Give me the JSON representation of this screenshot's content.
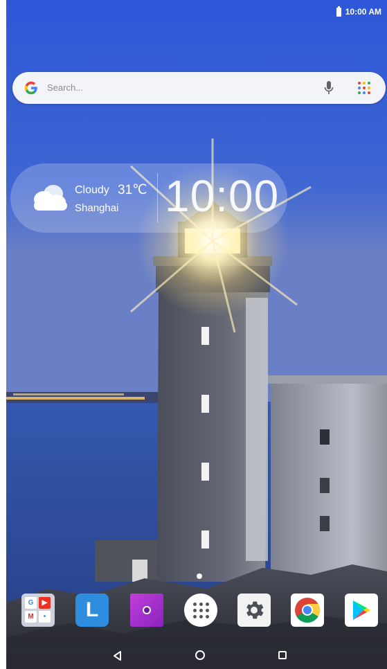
{
  "status_bar": {
    "time": "10:00 AM",
    "battery_icon": "battery-icon"
  },
  "search": {
    "placeholder": "Search...",
    "logo_icon": "google-g-icon",
    "mic_icon": "mic-icon",
    "apps_icon": "apps-grid-icon"
  },
  "weather_widget": {
    "condition": "Cloudy",
    "temperature": "31℃",
    "city": "Shanghai",
    "clock": "10:00",
    "icon": "cloud-icon"
  },
  "home": {
    "active_page": 1
  },
  "dock": {
    "apps": [
      {
        "name": "google-folder",
        "icon": "google-folder-icon",
        "letters": [
          "G",
          "▶",
          "M",
          "•"
        ]
      },
      {
        "name": "l-app",
        "icon": "l-app-icon",
        "glyph": "L"
      },
      {
        "name": "camera-app",
        "icon": "camera-icon"
      },
      {
        "name": "all-apps",
        "icon": "all-apps-icon"
      },
      {
        "name": "settings",
        "icon": "settings-gear-icon"
      },
      {
        "name": "chrome",
        "icon": "chrome-icon"
      },
      {
        "name": "play-store",
        "icon": "play-store-icon"
      }
    ]
  },
  "nav_bar": {
    "back_icon": "back-triangle-icon",
    "home_icon": "home-circle-icon",
    "recents_icon": "recents-square-icon"
  },
  "colors": {
    "sky_top": "#3a5ed0",
    "sky_bottom": "#4f6fc8",
    "sea": "#2d4f9e",
    "lighthouse": "#5a5d68",
    "light_glow": "#fff3c4",
    "search_bg": "#f3f4f7",
    "accent_blue": "#2f8de0"
  }
}
